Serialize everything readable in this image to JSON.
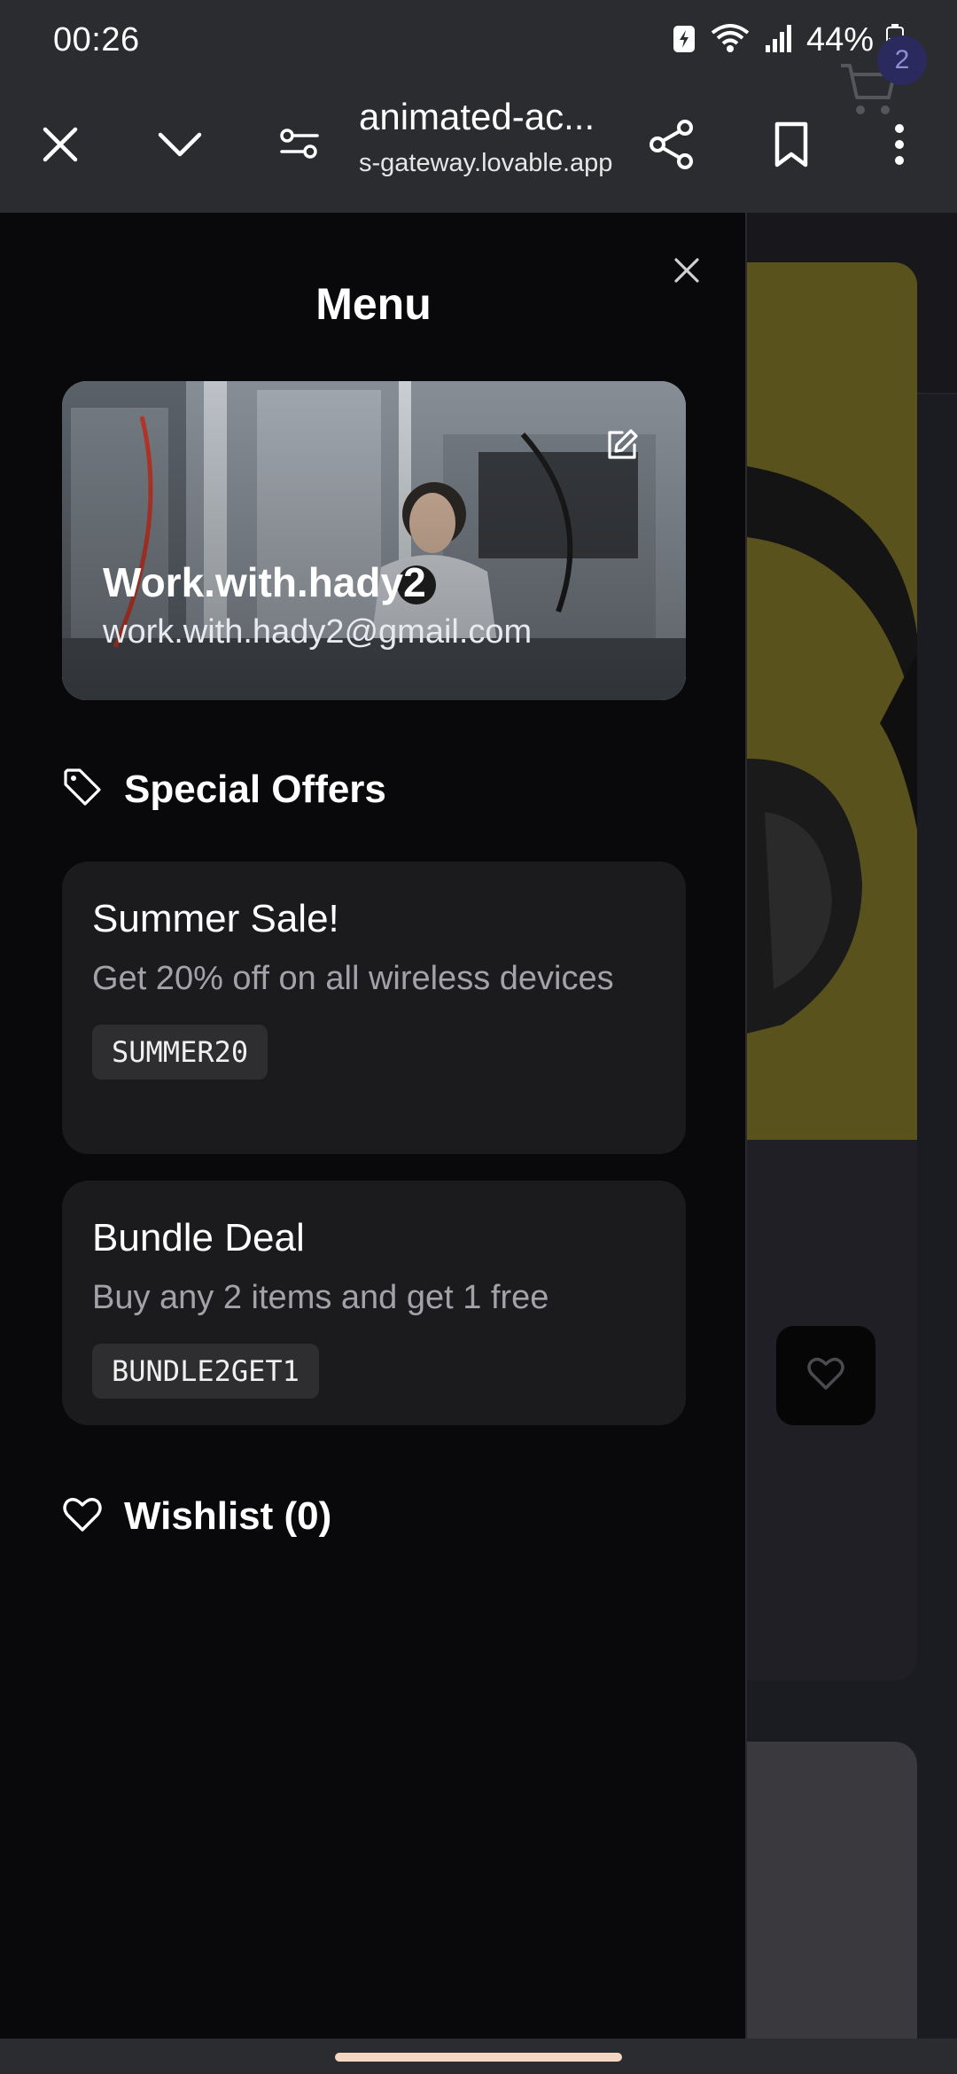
{
  "status_bar": {
    "time": "00:26",
    "battery": "44%"
  },
  "browser": {
    "title": "animated-ac...",
    "host": "s-gateway.lovable.app"
  },
  "page": {
    "cart_count": "2"
  },
  "drawer": {
    "title": "Menu",
    "profile": {
      "name": "Work.with.hady2",
      "email": "work.with.hady2@gmail.com"
    },
    "special_offers": {
      "heading": "Special Offers",
      "offers": [
        {
          "title": "Summer Sale!",
          "description": "Get 20% off on all wireless devices",
          "code": "SUMMER20"
        },
        {
          "title": "Bundle Deal",
          "description": "Buy any 2 items and get 1 free",
          "code": "BUNDLE2GET1"
        }
      ]
    },
    "wishlist": {
      "label": "Wishlist (0)"
    }
  },
  "colors": {
    "drawer_bg": "#09090b",
    "card_bg": "#1b1b1d",
    "accent_badge": "#2a2a5e"
  },
  "icons": {
    "close": "close-icon",
    "collapse": "chevron-down-icon",
    "page_settings": "sliders-icon",
    "share": "share-icon",
    "bookmark": "bookmark-icon",
    "more": "more-vertical-icon",
    "cart": "cart-icon",
    "edit": "edit-icon",
    "tag": "tag-icon",
    "heart": "heart-icon"
  }
}
